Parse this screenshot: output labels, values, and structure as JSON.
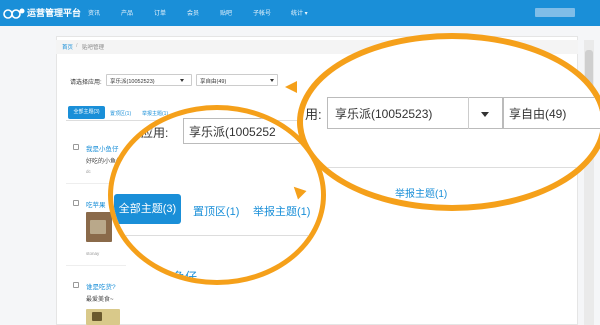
{
  "nav": {
    "brand": "运营管理平台",
    "links": [
      "资讯",
      "产品",
      "订单",
      "会员",
      "贴吧",
      "子帐号",
      "统计 ▾"
    ]
  },
  "breadcrumb": {
    "home": "首页",
    "separator": "/",
    "current": "贴吧管理"
  },
  "filter": {
    "label": "请选择应用:",
    "app_value": "享乐派(10052523)",
    "forum_value": "享自由(49)",
    "dropdown_icon": "caret-down-icon"
  },
  "tabs": {
    "all": "全部主题(3)",
    "pinned": "置顶区(1)",
    "reported": "举报主题(1)"
  },
  "posts": [
    {
      "title": "我是小鱼仔",
      "text": "好吃的小鱼仔~",
      "meta": "dc"
    },
    {
      "title": "吃苹果",
      "text": "",
      "meta": "stonay"
    },
    {
      "title": "谁是吃货?",
      "text": "最爱美食~",
      "meta": ""
    }
  ],
  "zoom_left": {
    "label_partial": "应用:",
    "app_partial": "享乐派(1005252",
    "tab_all": "全部主题(3)",
    "tab_pinned": "置顶区(1)",
    "tab_reported": "举报主题(1)",
    "post_partial": "小鱼仔"
  },
  "zoom_right": {
    "label_partial": "用:",
    "app_value": "享乐派(10052523)",
    "forum_value": "享自由(49)",
    "tab_reported": "举报主题(1)"
  },
  "colors": {
    "primary": "#1a8fd8",
    "highlight": "#f5a01a"
  }
}
